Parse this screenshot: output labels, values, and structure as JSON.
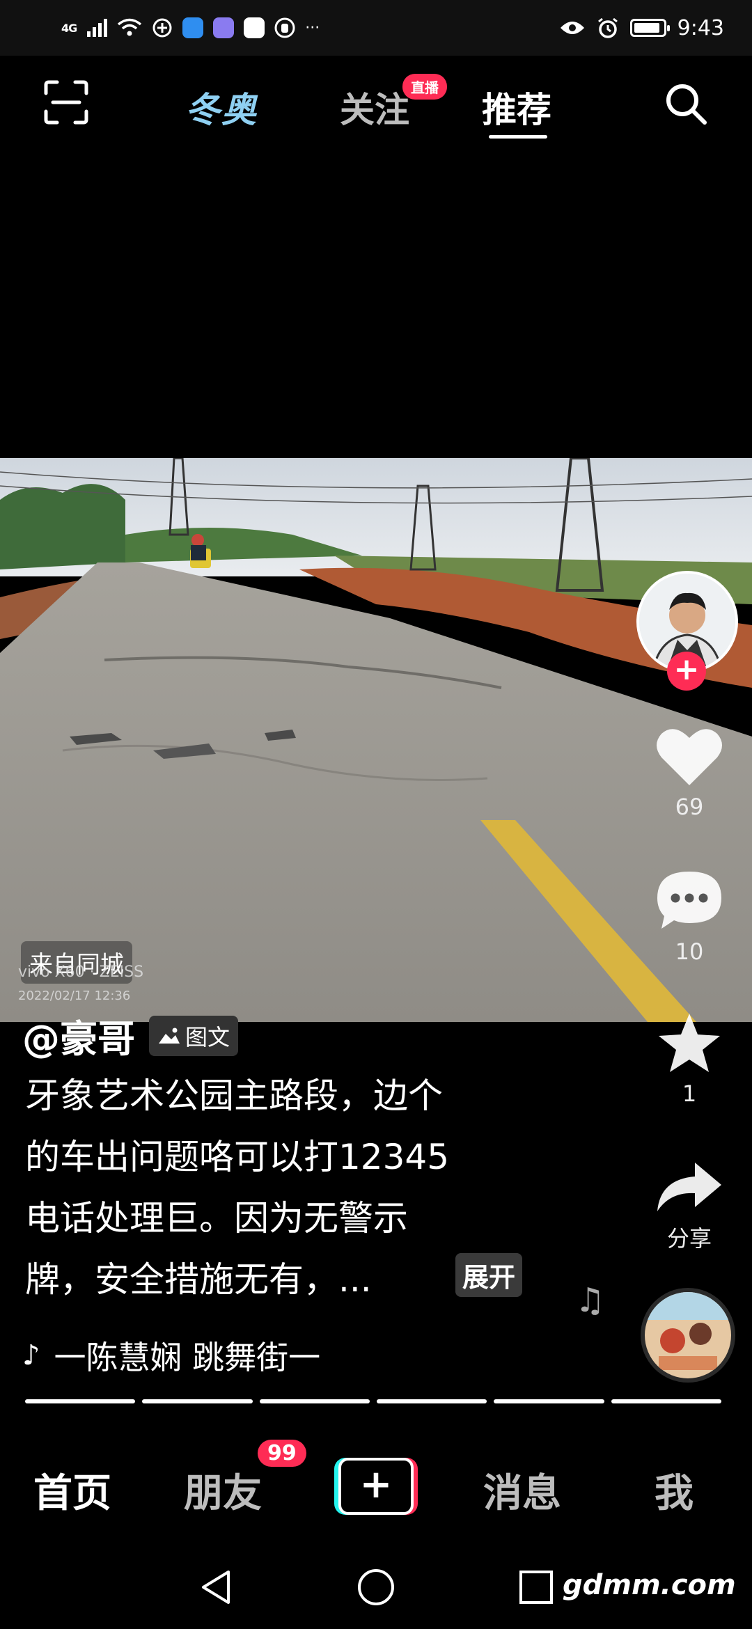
{
  "status_bar": {
    "network": "4G",
    "time": "9:43",
    "battery_level": 0.9
  },
  "top_nav": {
    "tabs": [
      {
        "label": "冬奥"
      },
      {
        "label": "关注",
        "badge": "直播"
      },
      {
        "label": "推荐"
      }
    ],
    "selected_tab": "推荐"
  },
  "post": {
    "location_tag": "来自同城",
    "camera_watermark": "vivo X60 · ZEISS",
    "photo_timestamp": "2022/02/17 12:36",
    "author": "@豪哥",
    "type_badge": "图文",
    "description_lines": [
      "牙象艺术公园主路段，边个",
      "的车出问题咯可以打12345",
      "电话处理巨。因为无警示",
      "牌，安全措施无有，..."
    ],
    "expand_label": "展开",
    "music": "一陈慧娴    跳舞街一",
    "image_count": 6
  },
  "actions": {
    "likes": "69",
    "comments": "10",
    "favorites": "1",
    "share_label": "分享"
  },
  "bottom_tabs": {
    "home": "首页",
    "friends": "朋友",
    "friends_badge": "99",
    "create": "+",
    "messages": "消息",
    "me": "我"
  },
  "watermark": "gdmm.com",
  "colors": {
    "accent_red": "#fe2c55",
    "accent_cyan": "#25f4ee",
    "winter_blue": "#8fd0f2"
  }
}
